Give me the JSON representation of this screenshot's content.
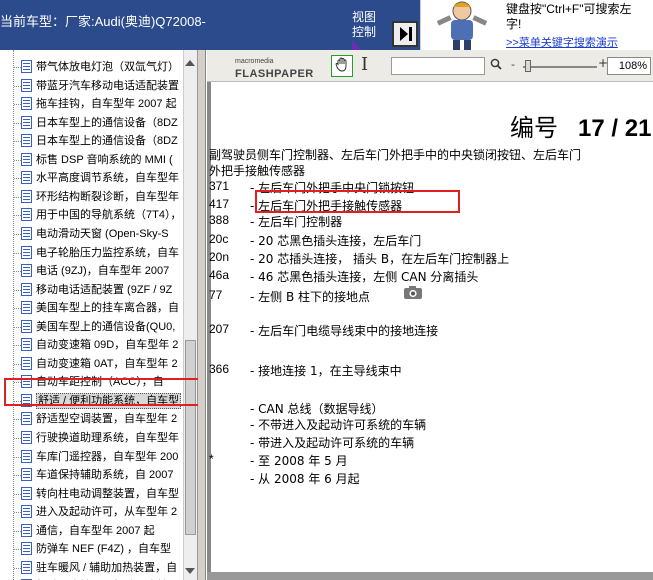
{
  "header": {
    "current_model": "当前车型：厂家:Audi(奥迪)Q72008-",
    "view_control_line1": "视图",
    "view_control_line2": "控制"
  },
  "banner": {
    "line1": "键盘按\"Ctrl+F\"可搜索左",
    "line2": "字!",
    "link": ">>菜单关键字搜索演示"
  },
  "tree": {
    "items": [
      "带气体放电灯泡（双氙气灯）",
      "带蓝牙汽车移动电话适配装置",
      "拖车挂钩，自车型年 2007 起",
      "日本车型上的通信设备（8DZ",
      "日本车型上的通信设备（8DZ",
      "标售 DSP 音响系统的 MMI (",
      "水平高度调节系统，自车型年",
      "环形结构断裂诊断，自车型年",
      "用于中国的导航系统（7T4），",
      "电动滑动天窗 (Open-Sky-S",
      "电子轮胎压力监控系统，自车",
      "电话 (9ZJ)，自车型年 2007",
      "移动电话适配装置 (9ZF / 9Z",
      "美国车型上的挂车离合器，自",
      "美国车型上的通信设备(QU0,",
      "自动变速箱 09D，自车型年 2",
      "自动变速箱 0AT，自车型年 2",
      "自动车距控制（ACC），自",
      "舒适 / 便利功能系统，自车型",
      "舒适型空调装置，自车型年 2",
      "行驶换道助理系统，自车型年",
      "车库门遥控器，自车型年 200",
      "车道保持辅助系统，自 2007",
      "转向柱电动调整装置，自车型",
      "进入及起动许可，从车型年 2",
      "通信，自车型年 2007 起",
      "防弹车 NEF (F4Z) ，自车型",
      "驻车暖风 / 辅助加热装置，自",
      "驾驶员座椅、副驾驶员座椅不"
    ],
    "selected_index": 18
  },
  "toolbar": {
    "logo_small": "macromedia",
    "logo_big": "FLASHPAPER",
    "zoom_minus": "-",
    "zoom_plus": "+",
    "zoom_value": "108%",
    "search_value": ""
  },
  "document": {
    "page_label": "编号",
    "page_value": "17 / 21",
    "intro_line1": "副驾驶员侧车门控制器、左后车门外把手中的中央锁闭按钮、左后车门",
    "intro_line2": "外把手接触传感器",
    "rows": [
      {
        "code": "371",
        "desc": "左后车门外把手中央门锁按钮"
      },
      {
        "code": "417",
        "desc": "左后车门外把手接触传感器"
      },
      {
        "code": "388",
        "desc": "左后车门控制器"
      },
      {
        "code": "20c",
        "desc": "20 芯黑色插头连接，左后车门"
      },
      {
        "code": "20n",
        "desc": "20 芯插头连接， 插头  B，在左后车门控制器上"
      },
      {
        "code": "46a",
        "desc": "46 芯黑色插头连接，左侧  CAN 分离插头"
      },
      {
        "code": "77",
        "desc": "左侧  B 柱下的接地点"
      },
      {
        "code": "207",
        "desc": "左后车门电缆导线束中的接地连接"
      },
      {
        "code": "366",
        "desc": "接地连接  1，在主导线束中"
      },
      {
        "code": "",
        "desc": "CAN 总线（数据导线）"
      },
      {
        "code": "",
        "desc": "不带进入及起动许可系统的车辆"
      },
      {
        "code": "",
        "desc": "带进入及起动许可系统的车辆"
      },
      {
        "code": "*",
        "desc": "至  2008 年  5 月"
      },
      {
        "code": "",
        "desc": "从  2008 年  6 月起"
      }
    ]
  }
}
